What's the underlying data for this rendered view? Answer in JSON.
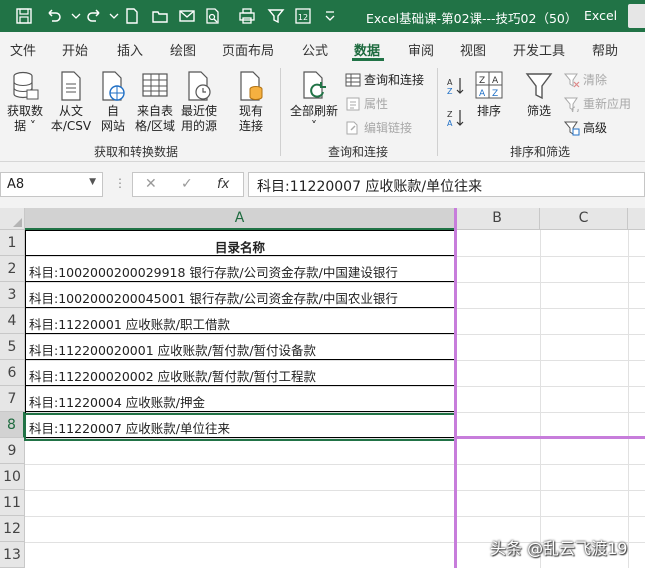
{
  "titlebar": {
    "document_title": "Excel基础课-第02课---技巧02（50）",
    "app_name": "Excel"
  },
  "tabs": [
    "文件",
    "开始",
    "插入",
    "绘图",
    "页面布局",
    "公式",
    "数据",
    "审阅",
    "视图",
    "开发工具",
    "帮助"
  ],
  "active_tab": "数据",
  "ribbon": {
    "get_data": "获取数\n据 ˅",
    "from_text_csv": "从文\n本/CSV",
    "from_web": "自\n网站",
    "from_table": "来自表\n格/区域",
    "recent_sources": "最近使\n用的源",
    "existing_connections": "现有\n连接",
    "group_get_transform": "获取和转换数据",
    "refresh_all": "全部刷新\n˅",
    "queries_connections": "查询和连接",
    "properties": "属性",
    "edit_links": "编辑链接",
    "group_queries": "查询和连接",
    "sort": "排序",
    "filter": "筛选",
    "clear": "清除",
    "reapply": "重新应用",
    "advanced": "高级",
    "group_sort_filter": "排序和筛选"
  },
  "formula_bar": {
    "name_box": "A8",
    "formula": "科目:11220007 应收账款/单位往来"
  },
  "sheet": {
    "columns": [
      "A",
      "B",
      "C"
    ],
    "rows": [
      "1",
      "2",
      "3",
      "4",
      "5",
      "6",
      "7",
      "8",
      "9",
      "10",
      "11",
      "12",
      "13"
    ],
    "cells": [
      "目录名称",
      "科目:1002000200029918 银行存款/公司资金存款/中国建设银行",
      "科目:1002000200045001 银行存款/公司资金存款/中国农业银行",
      "科目:11220001 应收账款/职工借款",
      "科目:112200020001 应收账款/暂付款/暂付设备款",
      "科目:112200020002 应收账款/暂付款/暂付工程款",
      "科目:11220004 应收账款/押金",
      "科目:11220007 应收账款/单位往来"
    ],
    "selected_cell": "A8"
  },
  "watermark": "头条 @乱云飞渡19",
  "colors": {
    "excel_green": "#217346",
    "page_break_line": "#c77ddb"
  }
}
